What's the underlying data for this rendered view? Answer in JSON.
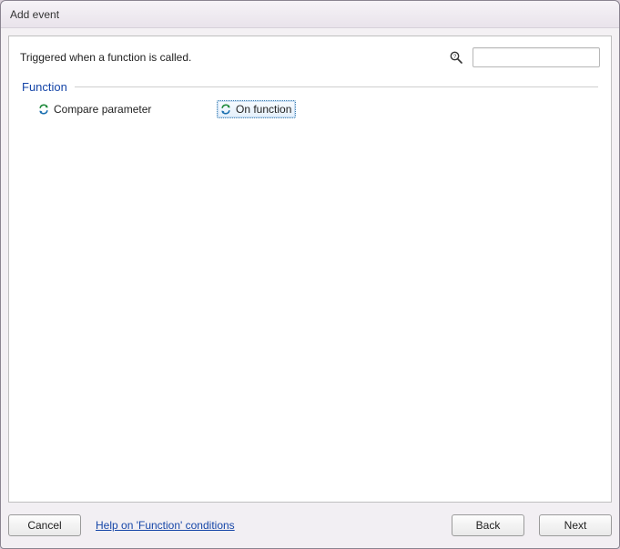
{
  "window": {
    "title": "Add event"
  },
  "header": {
    "description": "Triggered when a function is called.",
    "search_placeholder": ""
  },
  "section": {
    "title": "Function",
    "items": [
      {
        "label": "Compare parameter",
        "selected": false
      },
      {
        "label": "On function",
        "selected": true
      }
    ]
  },
  "footer": {
    "cancel": "Cancel",
    "help": "Help on 'Function' conditions",
    "back": "Back",
    "next": "Next"
  }
}
